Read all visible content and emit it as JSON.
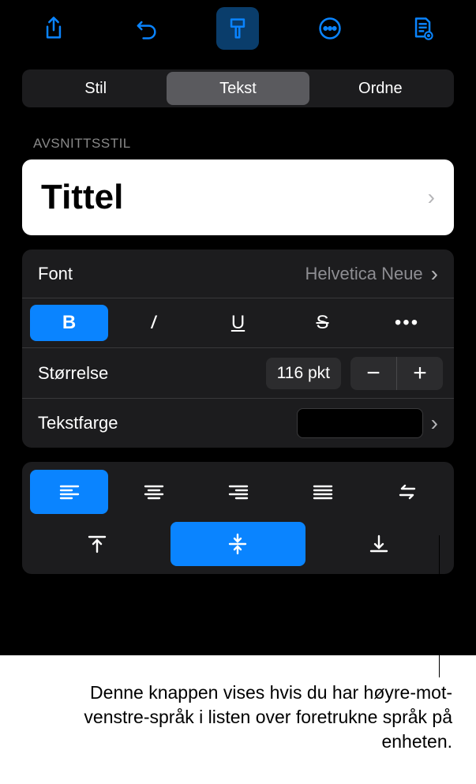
{
  "toolbar": {
    "icons": [
      "share-icon",
      "undo-icon",
      "format-brush-icon",
      "more-icon",
      "document-view-icon"
    ]
  },
  "tabs": {
    "items": [
      "Stil",
      "Tekst",
      "Ordne"
    ],
    "active": 1
  },
  "section_label": "AVSNITTSSTIL",
  "paragraph_style": {
    "value": "Tittel"
  },
  "font": {
    "label": "Font",
    "value": "Helvetica Neue"
  },
  "styles": {
    "bold": "B",
    "italic": "I",
    "underline": "U",
    "strike": "S",
    "more": "•••"
  },
  "size": {
    "label": "Størrelse",
    "value": "116 pkt",
    "minus": "−",
    "plus": "+"
  },
  "text_color": {
    "label": "Tekstfarge",
    "swatch": "#000000"
  },
  "callout": "Denne knappen vises hvis du har høyre-mot-venstre-språk i listen over foretrukne språk på enheten."
}
